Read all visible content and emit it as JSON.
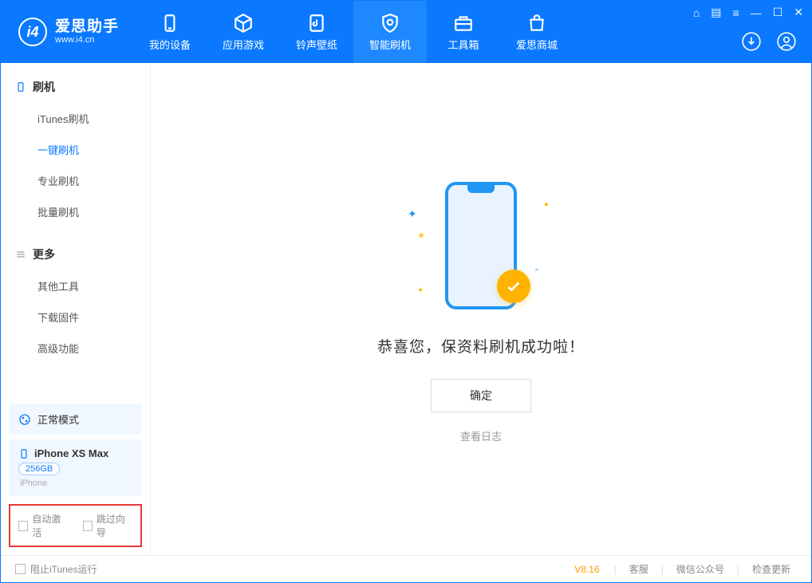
{
  "header": {
    "appName": "爱思助手",
    "appUrl": "www.i4.cn",
    "tabs": [
      {
        "label": "我的设备"
      },
      {
        "label": "应用游戏"
      },
      {
        "label": "铃声壁纸"
      },
      {
        "label": "智能刷机"
      },
      {
        "label": "工具箱"
      },
      {
        "label": "爱思商城"
      }
    ]
  },
  "sidebar": {
    "section1": {
      "title": "刷机"
    },
    "items1": [
      {
        "label": "iTunes刷机"
      },
      {
        "label": "一键刷机",
        "active": true
      },
      {
        "label": "专业刷机"
      },
      {
        "label": "批量刷机"
      }
    ],
    "section2": {
      "title": "更多"
    },
    "items2": [
      {
        "label": "其他工具"
      },
      {
        "label": "下载固件"
      },
      {
        "label": "高级功能"
      }
    ],
    "status": "正常模式",
    "device": {
      "model": "iPhone XS Max",
      "storage": "256GB",
      "type": "iPhone"
    },
    "checkboxes": {
      "autoActivate": "自动激活",
      "skipGuide": "跳过向导"
    }
  },
  "main": {
    "successText": "恭喜您，保资料刷机成功啦！",
    "confirmLabel": "确定",
    "viewLogLabel": "查看日志"
  },
  "footer": {
    "blockItunes": "阻止iTunes运行",
    "version": "V8.16",
    "links": [
      "客服",
      "微信公众号",
      "检查更新"
    ]
  }
}
